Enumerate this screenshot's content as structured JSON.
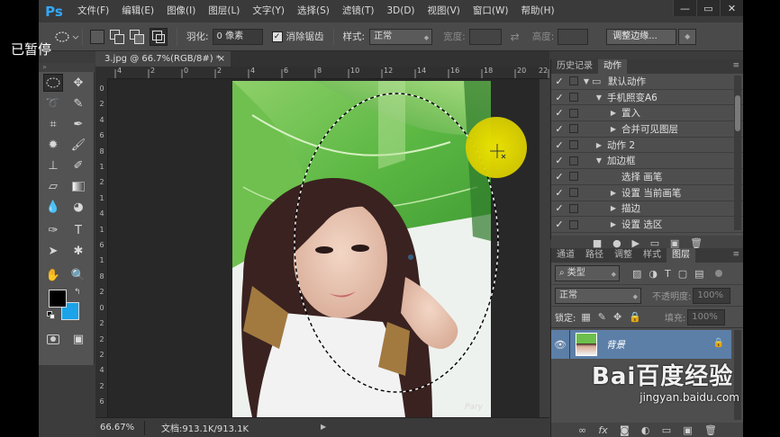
{
  "overlay": {
    "paused_label": "已暂停"
  },
  "app": {
    "logo": "Ps"
  },
  "menubar": {
    "items": [
      "文件(F)",
      "编辑(E)",
      "图像(I)",
      "图层(L)",
      "文字(Y)",
      "选择(S)",
      "滤镜(T)",
      "3D(D)",
      "视图(V)",
      "窗口(W)",
      "帮助(H)"
    ],
    "minimize": "—",
    "restore": "▭",
    "close": "✕"
  },
  "options": {
    "feather_label": "羽化:",
    "feather_value": "0 像素",
    "antialias_checked": true,
    "antialias_label": "消除锯齿",
    "style_label": "样式:",
    "style_value": "正常",
    "width_label": "宽度:",
    "height_label": "高度:",
    "refine_edge_button": "调整边缘..."
  },
  "document": {
    "tab_title": "3.jpg @ 66.7%(RGB/8#) *",
    "tab_close": "×",
    "ruler_h_labels": [
      "4",
      "2",
      "0",
      "2",
      "4",
      "6",
      "8",
      "10",
      "12",
      "14",
      "16",
      "18",
      "20",
      "22"
    ],
    "ruler_v_labels": [
      "0",
      "2",
      "4",
      "6",
      "8",
      "1",
      "2",
      "1",
      "4",
      "1",
      "6",
      "1",
      "8",
      "2",
      "0",
      "2",
      "2",
      "2",
      "4",
      "2",
      "6"
    ],
    "zoom": "66.67%",
    "doc_info": "文档:913.1K/913.1K",
    "watermark": "Pary"
  },
  "actions_panel": {
    "tabs": [
      "历史记录",
      "动作"
    ],
    "active_tab": 1,
    "rows": [
      {
        "level": 0,
        "expanded": true,
        "folder": true,
        "name": "默认动作"
      },
      {
        "level": 1,
        "expanded": true,
        "folder": false,
        "name": "手机照变A6"
      },
      {
        "level": 2,
        "expanded": false,
        "folder": false,
        "name": "置入"
      },
      {
        "level": 2,
        "expanded": false,
        "folder": false,
        "name": "合并可见图层"
      },
      {
        "level": 1,
        "expanded": false,
        "folder": false,
        "name": "动作 2"
      },
      {
        "level": 1,
        "expanded": true,
        "folder": false,
        "name": "加边框"
      },
      {
        "level": 2,
        "expanded": null,
        "folder": false,
        "name": "选择 画笔"
      },
      {
        "level": 2,
        "expanded": false,
        "folder": false,
        "name": "设置 当前画笔"
      },
      {
        "level": 2,
        "expanded": false,
        "folder": false,
        "name": "描边"
      },
      {
        "level": 2,
        "expanded": false,
        "folder": false,
        "name": "设置 选区"
      }
    ]
  },
  "layers_panel": {
    "tabs": [
      "通道",
      "路径",
      "调整",
      "样式",
      "图层"
    ],
    "active_tab": 4,
    "filter_kind": "类型",
    "blend_mode": "正常",
    "opacity_label": "不透明度:",
    "opacity_value": "100%",
    "lock_label": "锁定:",
    "fill_label": "填充:",
    "fill_value": "100%",
    "layers": [
      {
        "name": "背景",
        "locked": true,
        "visible": true
      }
    ]
  },
  "watermark_brand": {
    "text": "Bai百度经验",
    "url": "jingyan.baidu.com"
  },
  "colors": {
    "foreground": "#000000",
    "background": "#1aa3e8",
    "cursor_highlight": "#e6dc00",
    "layer_selected": "#5c7fa8"
  }
}
